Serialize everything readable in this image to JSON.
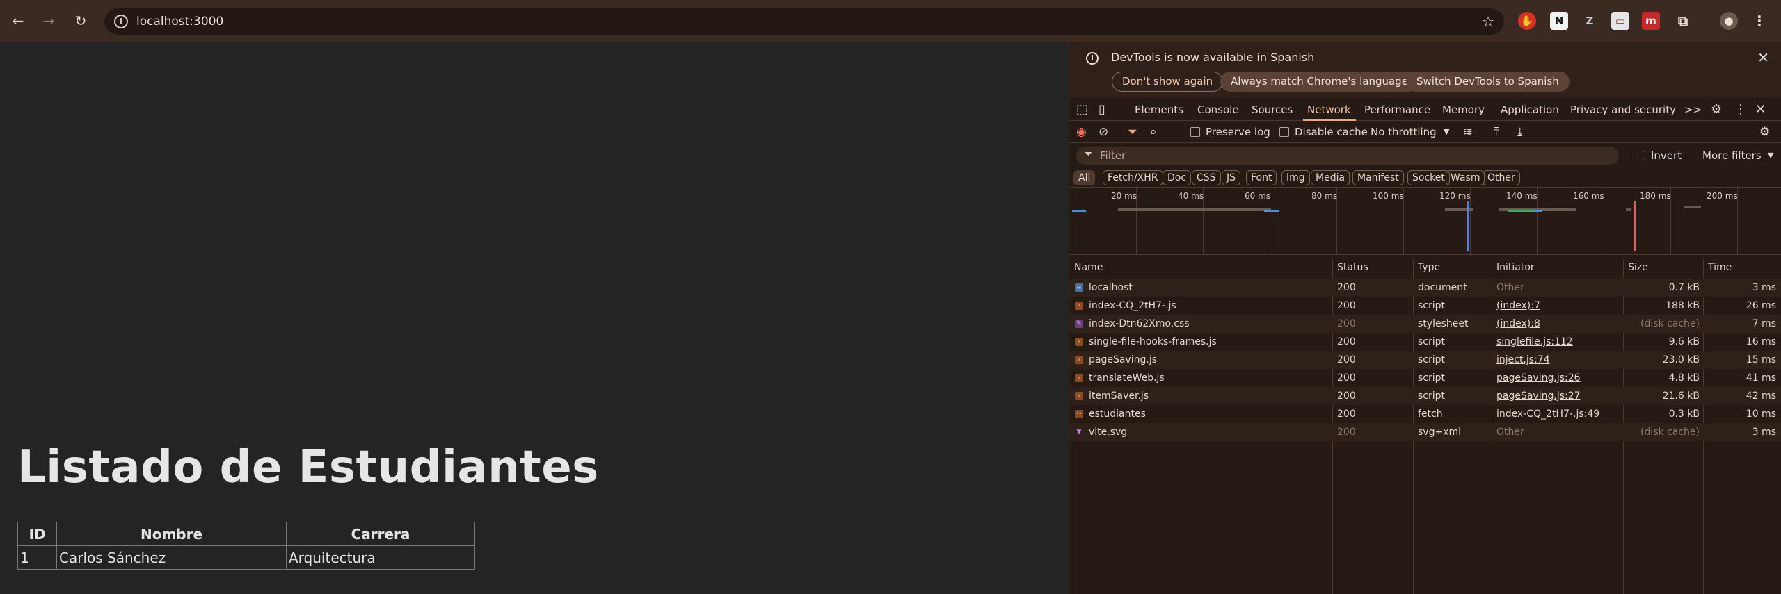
{
  "browser": {
    "url": "localhost:3000",
    "back_icon": "←",
    "forward_icon": "→",
    "reload_icon": "↻"
  },
  "page": {
    "title": "Listado de Estudiantes",
    "table": {
      "headers": [
        "ID",
        "Nombre",
        "Carrera"
      ],
      "rows": [
        [
          "1",
          "Carlos Sánchez",
          "Arquitectura"
        ]
      ]
    }
  },
  "devtools": {
    "infobar": {
      "message": "DevTools is now available in Spanish",
      "dont_show": "Don't show again",
      "always_match": "Always match Chrome's language",
      "switch": "Switch DevTools to Spanish"
    },
    "tabs": [
      "Elements",
      "Console",
      "Sources",
      "Network",
      "Performance",
      "Memory",
      "Application",
      "Privacy and security"
    ],
    "active_tab": "Network",
    "more_tabs": ">>",
    "toolbar": {
      "preserve_log": "Preserve log",
      "disable_cache": "Disable cache",
      "throttling": "No throttling"
    },
    "filter": {
      "placeholder": "Filter",
      "invert": "Invert",
      "more_filters": "More filters"
    },
    "type_filters": [
      "All",
      "Fetch/XHR",
      "Doc",
      "CSS",
      "JS",
      "Font",
      "Img",
      "Media",
      "Manifest",
      "Socket",
      "Wasm",
      "Other"
    ],
    "timeline_ticks": [
      "20 ms",
      "40 ms",
      "60 ms",
      "80 ms",
      "100 ms",
      "120 ms",
      "140 ms",
      "160 ms",
      "180 ms",
      "200 ms"
    ],
    "columns": [
      "Name",
      "Status",
      "Type",
      "Initiator",
      "Size",
      "Time"
    ],
    "requests": [
      {
        "name": "localhost",
        "status": "200",
        "type": "document",
        "initiator": "Other",
        "size": "0.7 kB",
        "time": "3 ms",
        "icon": "doc",
        "initiator_link": false,
        "dim_status": false,
        "dim_size": false
      },
      {
        "name": "index-CQ_2tH7-.js",
        "status": "200",
        "type": "script",
        "initiator": "(index):7",
        "size": "188 kB",
        "time": "26 ms",
        "icon": "js",
        "initiator_link": true,
        "dim_status": false,
        "dim_size": false
      },
      {
        "name": "index-Dtn62Xmo.css",
        "status": "200",
        "type": "stylesheet",
        "initiator": "(index):8",
        "size": "(disk cache)",
        "time": "7 ms",
        "icon": "css",
        "initiator_link": true,
        "dim_status": true,
        "dim_size": true
      },
      {
        "name": "single-file-hooks-frames.js",
        "status": "200",
        "type": "script",
        "initiator": "singlefile.js:112",
        "size": "9.6 kB",
        "time": "16 ms",
        "icon": "js",
        "initiator_link": true,
        "dim_status": false,
        "dim_size": false
      },
      {
        "name": "pageSaving.js",
        "status": "200",
        "type": "script",
        "initiator": "inject.js:74",
        "size": "23.0 kB",
        "time": "15 ms",
        "icon": "js",
        "initiator_link": true,
        "dim_status": false,
        "dim_size": false
      },
      {
        "name": "translateWeb.js",
        "status": "200",
        "type": "script",
        "initiator": "pageSaving.js:26",
        "size": "4.8 kB",
        "time": "41 ms",
        "icon": "js",
        "initiator_link": true,
        "dim_status": false,
        "dim_size": false
      },
      {
        "name": "itemSaver.js",
        "status": "200",
        "type": "script",
        "initiator": "pageSaving.js:27",
        "size": "21.6 kB",
        "time": "42 ms",
        "icon": "js",
        "initiator_link": true,
        "dim_status": false,
        "dim_size": false
      },
      {
        "name": "estudiantes",
        "status": "200",
        "type": "fetch",
        "initiator": "index-CQ_2tH7-.js:49",
        "size": "0.3 kB",
        "time": "10 ms",
        "icon": "fetch",
        "initiator_link": true,
        "dim_status": false,
        "dim_size": false
      },
      {
        "name": "vite.svg",
        "status": "200",
        "type": "svg+xml",
        "initiator": "Other",
        "size": "(disk cache)",
        "time": "3 ms",
        "icon": "img",
        "initiator_link": false,
        "dim_status": true,
        "dim_size": true
      }
    ]
  },
  "colors": {
    "accent": "#f0a877",
    "chrome_bg": "#3b2a22",
    "devtools_bg": "#261a14",
    "page_bg": "#242424"
  }
}
